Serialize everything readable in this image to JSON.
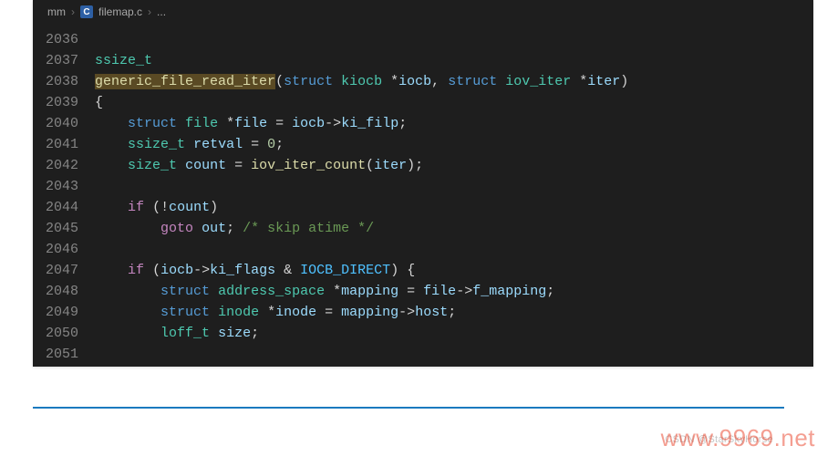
{
  "breadcrumb": {
    "segments": [
      "mm",
      "filemap.c",
      "..."
    ],
    "icon_label": "C"
  },
  "gutter": {
    "start": 2036,
    "end": 2051
  },
  "code": {
    "lines": [
      [],
      [
        {
          "cls": "tok-type",
          "txt": "ssize_t"
        }
      ],
      [
        {
          "cls": "tok-fn fn-hl",
          "txt": "generic_file_read_iter"
        },
        {
          "cls": "tok-op",
          "txt": "("
        },
        {
          "cls": "tok-kw",
          "txt": "struct"
        },
        {
          "cls": "",
          "txt": " "
        },
        {
          "cls": "tok-type",
          "txt": "kiocb"
        },
        {
          "cls": "",
          "txt": " "
        },
        {
          "cls": "tok-op",
          "txt": "*"
        },
        {
          "cls": "tok-id",
          "txt": "iocb"
        },
        {
          "cls": "tok-op",
          "txt": ", "
        },
        {
          "cls": "tok-kw",
          "txt": "struct"
        },
        {
          "cls": "",
          "txt": " "
        },
        {
          "cls": "tok-type",
          "txt": "iov_iter"
        },
        {
          "cls": "",
          "txt": " "
        },
        {
          "cls": "tok-op",
          "txt": "*"
        },
        {
          "cls": "tok-id",
          "txt": "iter"
        },
        {
          "cls": "tok-op",
          "txt": ")"
        }
      ],
      [
        {
          "cls": "tok-op",
          "txt": "{"
        }
      ],
      [
        {
          "cls": "",
          "txt": "    "
        },
        {
          "cls": "tok-kw",
          "txt": "struct"
        },
        {
          "cls": "",
          "txt": " "
        },
        {
          "cls": "tok-type",
          "txt": "file"
        },
        {
          "cls": "",
          "txt": " "
        },
        {
          "cls": "tok-op",
          "txt": "*"
        },
        {
          "cls": "tok-id",
          "txt": "file"
        },
        {
          "cls": "",
          "txt": " "
        },
        {
          "cls": "tok-op",
          "txt": "= "
        },
        {
          "cls": "tok-id",
          "txt": "iocb"
        },
        {
          "cls": "tok-op",
          "txt": "->"
        },
        {
          "cls": "tok-id",
          "txt": "ki_filp"
        },
        {
          "cls": "tok-op",
          "txt": ";"
        }
      ],
      [
        {
          "cls": "",
          "txt": "    "
        },
        {
          "cls": "tok-type",
          "txt": "ssize_t"
        },
        {
          "cls": "",
          "txt": " "
        },
        {
          "cls": "tok-id",
          "txt": "retval"
        },
        {
          "cls": "",
          "txt": " "
        },
        {
          "cls": "tok-op",
          "txt": "= "
        },
        {
          "cls": "tok-num",
          "txt": "0"
        },
        {
          "cls": "tok-op",
          "txt": ";"
        }
      ],
      [
        {
          "cls": "",
          "txt": "    "
        },
        {
          "cls": "tok-type",
          "txt": "size_t"
        },
        {
          "cls": "",
          "txt": " "
        },
        {
          "cls": "tok-id",
          "txt": "count"
        },
        {
          "cls": "",
          "txt": " "
        },
        {
          "cls": "tok-op",
          "txt": "= "
        },
        {
          "cls": "tok-fn",
          "txt": "iov_iter_count"
        },
        {
          "cls": "tok-op",
          "txt": "("
        },
        {
          "cls": "tok-id",
          "txt": "iter"
        },
        {
          "cls": "tok-op",
          "txt": ");"
        }
      ],
      [],
      [
        {
          "cls": "",
          "txt": "    "
        },
        {
          "cls": "tok-cflow",
          "txt": "if"
        },
        {
          "cls": "",
          "txt": " "
        },
        {
          "cls": "tok-op",
          "txt": "(!"
        },
        {
          "cls": "tok-id",
          "txt": "count"
        },
        {
          "cls": "tok-op",
          "txt": ")"
        }
      ],
      [
        {
          "cls": "",
          "txt": "        "
        },
        {
          "cls": "tok-cflow",
          "txt": "goto"
        },
        {
          "cls": "",
          "txt": " "
        },
        {
          "cls": "tok-id",
          "txt": "out"
        },
        {
          "cls": "tok-op",
          "txt": ";"
        },
        {
          "cls": "",
          "txt": " "
        },
        {
          "cls": "tok-cmt",
          "txt": "/* skip atime */"
        }
      ],
      [],
      [
        {
          "cls": "",
          "txt": "    "
        },
        {
          "cls": "tok-cflow",
          "txt": "if"
        },
        {
          "cls": "",
          "txt": " "
        },
        {
          "cls": "tok-op",
          "txt": "("
        },
        {
          "cls": "tok-id",
          "txt": "iocb"
        },
        {
          "cls": "tok-op",
          "txt": "->"
        },
        {
          "cls": "tok-id",
          "txt": "ki_flags"
        },
        {
          "cls": "",
          "txt": " "
        },
        {
          "cls": "tok-op",
          "txt": "& "
        },
        {
          "cls": "tok-const",
          "txt": "IOCB_DIRECT"
        },
        {
          "cls": "tok-op",
          "txt": ") {"
        }
      ],
      [
        {
          "cls": "",
          "txt": "        "
        },
        {
          "cls": "tok-kw",
          "txt": "struct"
        },
        {
          "cls": "",
          "txt": " "
        },
        {
          "cls": "tok-type",
          "txt": "address_space"
        },
        {
          "cls": "",
          "txt": " "
        },
        {
          "cls": "tok-op",
          "txt": "*"
        },
        {
          "cls": "tok-id",
          "txt": "mapping"
        },
        {
          "cls": "",
          "txt": " "
        },
        {
          "cls": "tok-op",
          "txt": "= "
        },
        {
          "cls": "tok-id",
          "txt": "file"
        },
        {
          "cls": "tok-op",
          "txt": "->"
        },
        {
          "cls": "tok-id",
          "txt": "f_mapping"
        },
        {
          "cls": "tok-op",
          "txt": ";"
        }
      ],
      [
        {
          "cls": "",
          "txt": "        "
        },
        {
          "cls": "tok-kw",
          "txt": "struct"
        },
        {
          "cls": "",
          "txt": " "
        },
        {
          "cls": "tok-type",
          "txt": "inode"
        },
        {
          "cls": "",
          "txt": " "
        },
        {
          "cls": "tok-op",
          "txt": "*"
        },
        {
          "cls": "tok-id",
          "txt": "inode"
        },
        {
          "cls": "",
          "txt": " "
        },
        {
          "cls": "tok-op",
          "txt": "= "
        },
        {
          "cls": "tok-id",
          "txt": "mapping"
        },
        {
          "cls": "tok-op",
          "txt": "->"
        },
        {
          "cls": "tok-id",
          "txt": "host"
        },
        {
          "cls": "tok-op",
          "txt": ";"
        }
      ],
      [
        {
          "cls": "",
          "txt": "        "
        },
        {
          "cls": "tok-type",
          "txt": "loff_t"
        },
        {
          "cls": "",
          "txt": " "
        },
        {
          "cls": "tok-id",
          "txt": "size"
        },
        {
          "cls": "tok-op",
          "txt": ";"
        }
      ],
      []
    ]
  },
  "footer": {
    "credit": "CSDN @StarSkyHorse",
    "watermark": "www.9969.net"
  }
}
